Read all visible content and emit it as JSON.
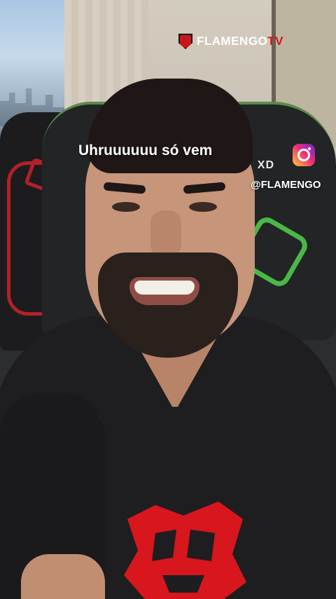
{
  "overlay": {
    "channel_logo_text": "FLAMENGO",
    "channel_logo_suffix": "TV",
    "caption": "Uhruuuuuu só vem",
    "social_icon": "instagram-icon",
    "social_handle": "@FLAMENGO",
    "chair_brand": "XD"
  },
  "colors": {
    "flamengo_red": "#d8141c",
    "chair_accent_green": "#49b846",
    "chair_accent_red": "#b3202a"
  }
}
